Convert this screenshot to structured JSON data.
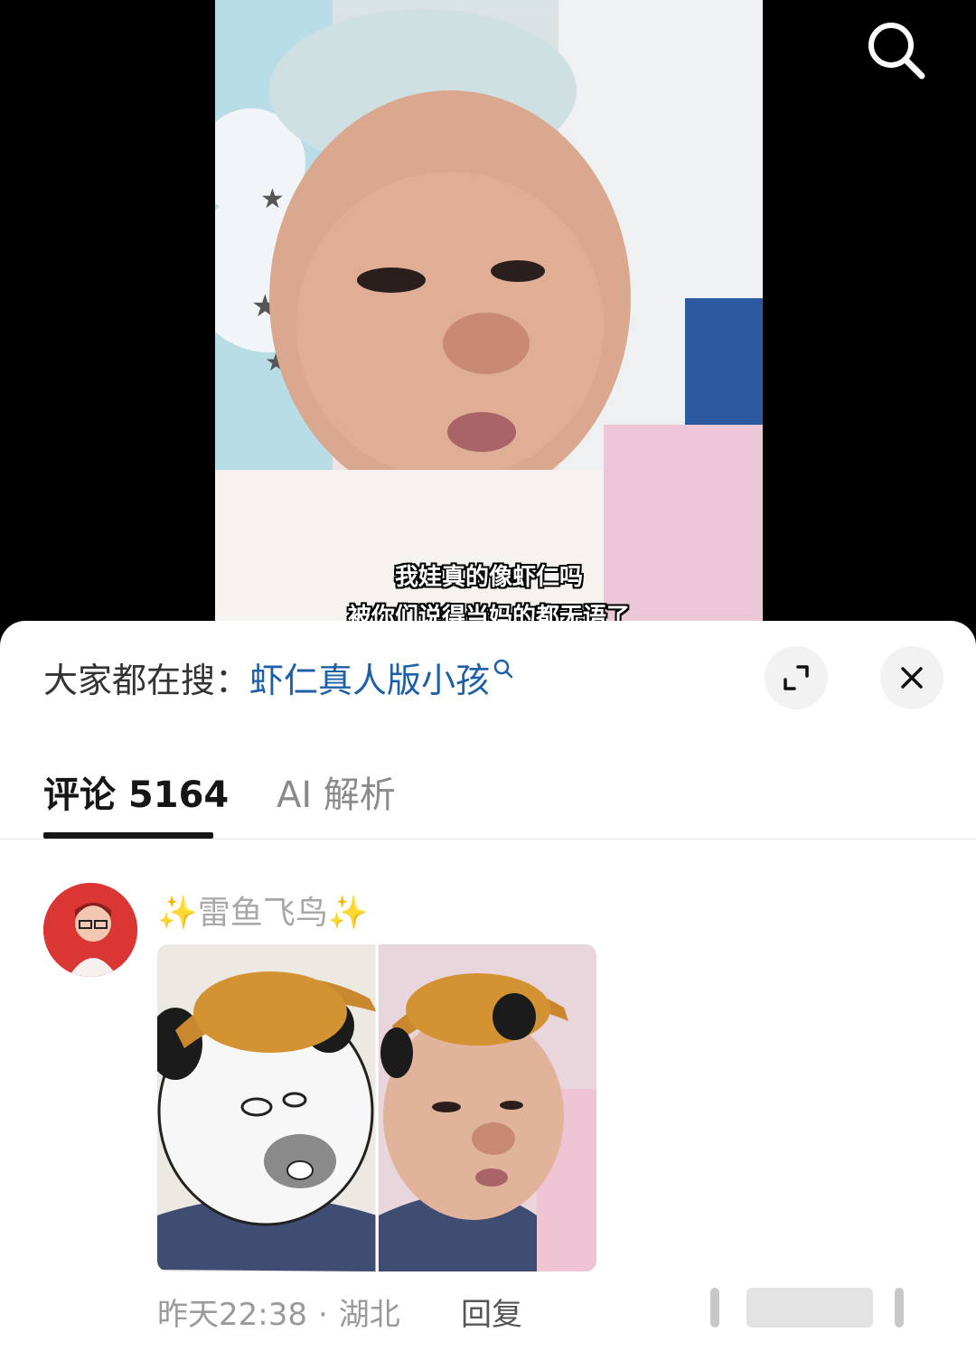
{
  "video": {
    "subtitle_line1": "我娃真的像虾仁吗",
    "subtitle_line2": "被你们说得当妈的都无语了",
    "search_icon": "search-icon"
  },
  "sheet": {
    "hot_search_prefix": "大家都在搜：",
    "hot_search_term": "虾仁真人版小孩",
    "expand_icon": "expand-icon",
    "close_icon": "close-icon"
  },
  "tabs": [
    {
      "label": "评论 5164",
      "active": true
    },
    {
      "label": "AI 解析",
      "active": false
    }
  ],
  "comment": {
    "username_sparkle_left": "✨",
    "username": "雷鱼飞鸟",
    "username_sparkle_right": "✨",
    "time": "昨天22:38",
    "separator": "·",
    "location": "湖北",
    "reply_label": "回复"
  },
  "colors": {
    "link_blue": "#1d5fa8",
    "avatar_red": "#d93634"
  }
}
